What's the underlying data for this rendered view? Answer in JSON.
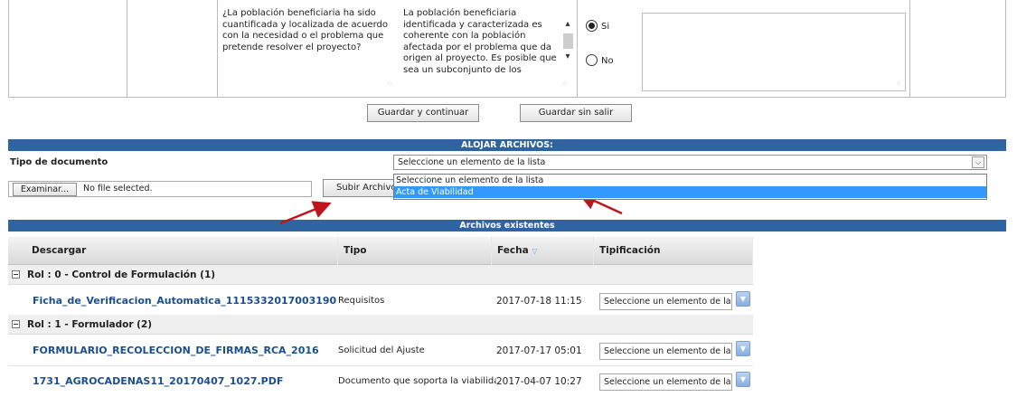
{
  "question": {
    "text": "¿La población beneficiaria ha sido cuantificada y localizada de acuerdo con la necesidad o el problema que pretende resolver el proyecto?",
    "response_text": "La población beneficiaria identificada y caracterizada es coherente con la población afectada por el problema que da origen al proyecto. Es posible que sea un subconjunto de los",
    "option_yes": "Si",
    "option_no": "No",
    "selected": "Si"
  },
  "actions": {
    "save_continue": "Guardar y continuar",
    "save_stay": "Guardar sin salir"
  },
  "upload": {
    "header": "ALOJAR ARCHIVOS:",
    "doc_type_label": "Tipo de documento",
    "select_value": "Seleccione un elemento de la lista",
    "options": [
      "Seleccione un elemento de la lista",
      "Acta de Viabilidad"
    ],
    "highlighted_option": "Acta de Viabilidad",
    "browse_label": "Examinar...",
    "file_status": "No file selected.",
    "upload_label": "Subir Archivo"
  },
  "files": {
    "header": "Archivos existentes",
    "columns": {
      "download": "Descargar",
      "type": "Tipo",
      "date": "Fecha",
      "class": "Tipificación"
    },
    "groups": [
      {
        "label": "Rol : 0 - Control de Formulación (1)",
        "rows": [
          {
            "name": "Ficha_de_Verificacion_Automatica_1115332017003190",
            "type": "Requisitos",
            "date": "2017-07-18 11:15",
            "class": "Seleccione un elemento de la lista"
          }
        ]
      },
      {
        "label": "Rol : 1 - Formulador (2)",
        "rows": [
          {
            "name": "FORMULARIO_RECOLECCION_DE_FIRMAS_RCA_2016",
            "type": "Solicitud del Ajuste",
            "date": "2017-07-17 05:01",
            "class": "Seleccione un elemento de la lista"
          },
          {
            "name": "1731_AGROCADENAS11_20170407_1027.PDF",
            "type": "Documento que soporta la viabilidad",
            "date": "2017-04-07 10:27",
            "class": "Seleccione un elemento de la lista"
          }
        ]
      }
    ]
  },
  "colors": {
    "header_blue": "#2f64a2",
    "link_blue": "#1b4f8c",
    "highlight": "#3399ff",
    "arrow_red": "#c0141c"
  }
}
